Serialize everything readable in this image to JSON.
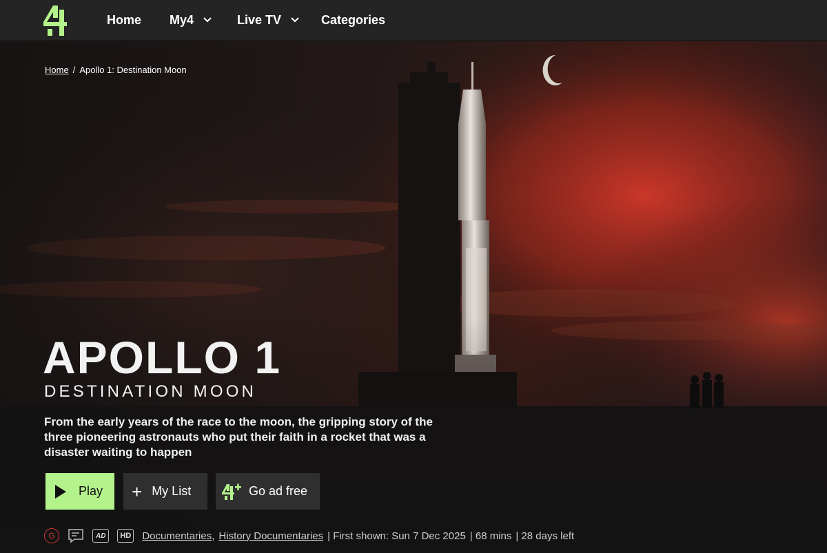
{
  "nav": {
    "items": [
      {
        "label": "Home"
      },
      {
        "label": "My4"
      },
      {
        "label": "Live TV"
      },
      {
        "label": "Categories"
      }
    ]
  },
  "breadcrumb": {
    "home": "Home",
    "separator": "/",
    "current": "Apollo 1: Destination Moon"
  },
  "programme": {
    "title": "APOLLO 1",
    "subtitle": "DESTINATION MOON",
    "description": "From the early years of the race to the moon, the gripping story of the three pioneering astronauts who put their faith in a rocket that was a disaster waiting to happen"
  },
  "actions": {
    "play": "Play",
    "my_list": "My List",
    "ad_free": "Go ad free"
  },
  "meta": {
    "rating": "G",
    "ad_label": "AD",
    "hd_label": "HD",
    "genre_1": "Documentaries",
    "genre_sep": ",",
    "genre_2": "History Documentaries",
    "first_shown": "| First shown: Sun 7 Dec 2025",
    "duration": "| 68 mins",
    "availability": "| 28 days left"
  },
  "colors": {
    "accent": "#b4f38c",
    "nav_bg": "#242424",
    "rating_red": "#d23b33"
  }
}
